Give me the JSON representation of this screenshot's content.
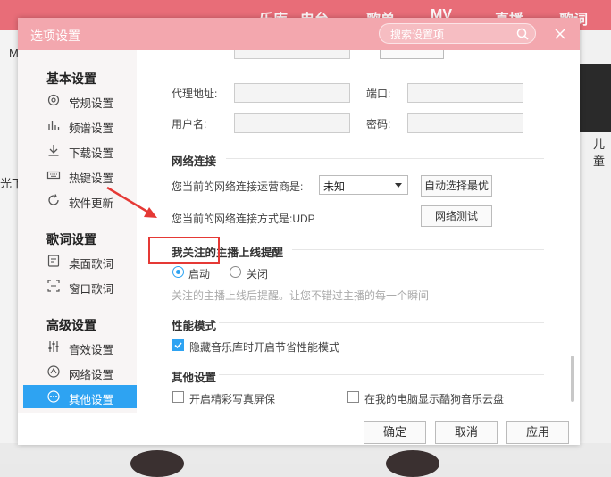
{
  "background": {
    "tabs": [
      "乐库",
      "电台",
      "歌单",
      "MV",
      "直播",
      "歌词"
    ],
    "left_snippets": [
      "M",
      "光下"
    ],
    "right_snippet": "儿童"
  },
  "dialog": {
    "title": "选项设置",
    "search_placeholder": "搜索设置项"
  },
  "sidebar": {
    "groups": [
      {
        "title": "基本设置",
        "items": [
          {
            "label": "常规设置",
            "icon": "gear-icon"
          },
          {
            "label": "频谱设置",
            "icon": "spectrum-icon"
          },
          {
            "label": "下载设置",
            "icon": "download-icon"
          },
          {
            "label": "热键设置",
            "icon": "keyboard-icon"
          },
          {
            "label": "软件更新",
            "icon": "refresh-icon"
          }
        ]
      },
      {
        "title": "歌词设置",
        "items": [
          {
            "label": "桌面歌词",
            "icon": "desktop-lyrics-icon"
          },
          {
            "label": "窗口歌词",
            "icon": "window-lyrics-icon"
          }
        ]
      },
      {
        "title": "高级设置",
        "items": [
          {
            "label": "音效设置",
            "icon": "equalizer-icon"
          },
          {
            "label": "网络设置",
            "icon": "network-icon"
          },
          {
            "label": "其他设置",
            "icon": "more-icon",
            "active": true
          }
        ]
      }
    ]
  },
  "proxy": {
    "address_label": "代理地址:",
    "port_label": "端口:",
    "username_label": "用户名:",
    "password_label": "密码:"
  },
  "network": {
    "section_title": "网络连接",
    "provider_label": "您当前的网络连接运营商是:",
    "provider_value": "未知",
    "auto_select_button": "自动选择最优",
    "method_label": "您当前的网络连接方式是:UDP",
    "test_button": "网络测试"
  },
  "anchor_reminder": {
    "section_title": "我关注的主播上线提醒",
    "on_label": "启动",
    "off_label": "关闭",
    "selected": "on",
    "hint": "关注的主播上线后提醒。让您不错过主播的每一个瞬间"
  },
  "performance": {
    "section_title": "性能模式",
    "checkbox_label": "隐藏音乐库时开启节省性能模式",
    "checked": true
  },
  "other": {
    "section_title": "其他设置",
    "screensaver_label": "开启精彩写真屏保",
    "cloud_disk_label": "在我的电脑显示酷狗音乐云盘"
  },
  "footer": {
    "ok": "确定",
    "cancel": "取消",
    "apply": "应用"
  },
  "colors": {
    "title_bar": "#f3a7ae",
    "accent": "#2ea3f2",
    "highlight": "#e53935"
  }
}
